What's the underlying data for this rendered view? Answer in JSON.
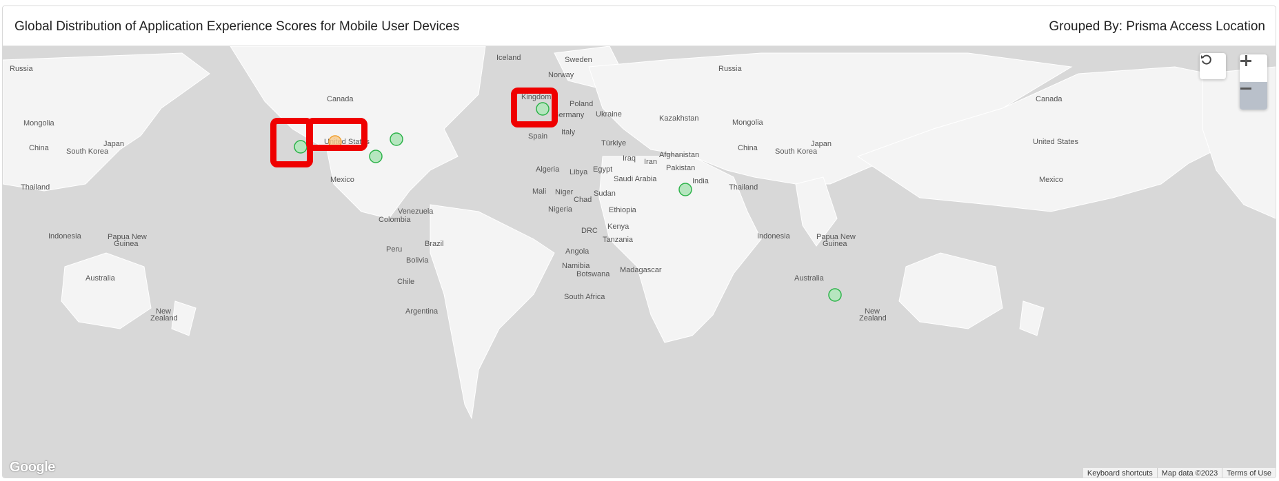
{
  "header": {
    "title": "Global Distribution of Application Experience Scores for Mobile User Devices",
    "grouped_by": "Grouped By: Prisma Access Location"
  },
  "map": {
    "attribution": {
      "keyboard_shortcuts": "Keyboard shortcuts",
      "map_data": "Map data ©2023",
      "terms": "Terms of Use"
    },
    "logo": "Google",
    "labels": [
      "Russia",
      "Canada",
      "Mongolia",
      "China",
      "South Korea",
      "Japan",
      "Thailand",
      "Indonesia",
      "Papua New",
      "Guinea",
      "Australia",
      "New",
      "Zealand",
      "United States",
      "Mexico",
      "Venezuela",
      "Colombia",
      "Peru",
      "Brazil",
      "Bolivia",
      "Chile",
      "Argentina",
      "Iceland",
      "Sweden",
      "Norway",
      "Kingdom",
      "Poland",
      "Germany",
      "Ukraine",
      "Spain",
      "Italy",
      "Türkiye",
      "Kazakhstan",
      "Iraq",
      "Iran",
      "Afghanistan",
      "Pakistan",
      "India",
      "Algeria",
      "Libya",
      "Egypt",
      "Saudi Arabia",
      "Mali",
      "Niger",
      "Chad",
      "Sudan",
      "Nigeria",
      "Ethiopia",
      "DRC",
      "Kenya",
      "Tanzania",
      "Angola",
      "Namibia",
      "Botswana",
      "Madagascar",
      "South Africa",
      "Mongolia",
      "China",
      "South Korea",
      "Japan",
      "Thailand",
      "Indonesia",
      "Papua New",
      "Guinea",
      "Australia",
      "New",
      "Zealand",
      "United States",
      "Mexico",
      "Russia",
      "Canada"
    ],
    "markers": [
      {
        "location": "US West",
        "status": "good",
        "color": "#2db34a"
      },
      {
        "location": "US Central",
        "status": "fair",
        "color": "#f0a030"
      },
      {
        "location": "US East",
        "status": "good",
        "color": "#2db34a"
      },
      {
        "location": "US Southeast",
        "status": "good",
        "color": "#2db34a"
      },
      {
        "location": "United Kingdom",
        "status": "good",
        "color": "#2db34a"
      },
      {
        "location": "India",
        "status": "good",
        "color": "#2db34a"
      },
      {
        "location": "Australia",
        "status": "good",
        "color": "#2db34a"
      }
    ],
    "controls": {
      "reset_icon": "reset-icon",
      "zoom_in_icon": "plus-icon",
      "zoom_out_icon": "minus-icon"
    }
  }
}
